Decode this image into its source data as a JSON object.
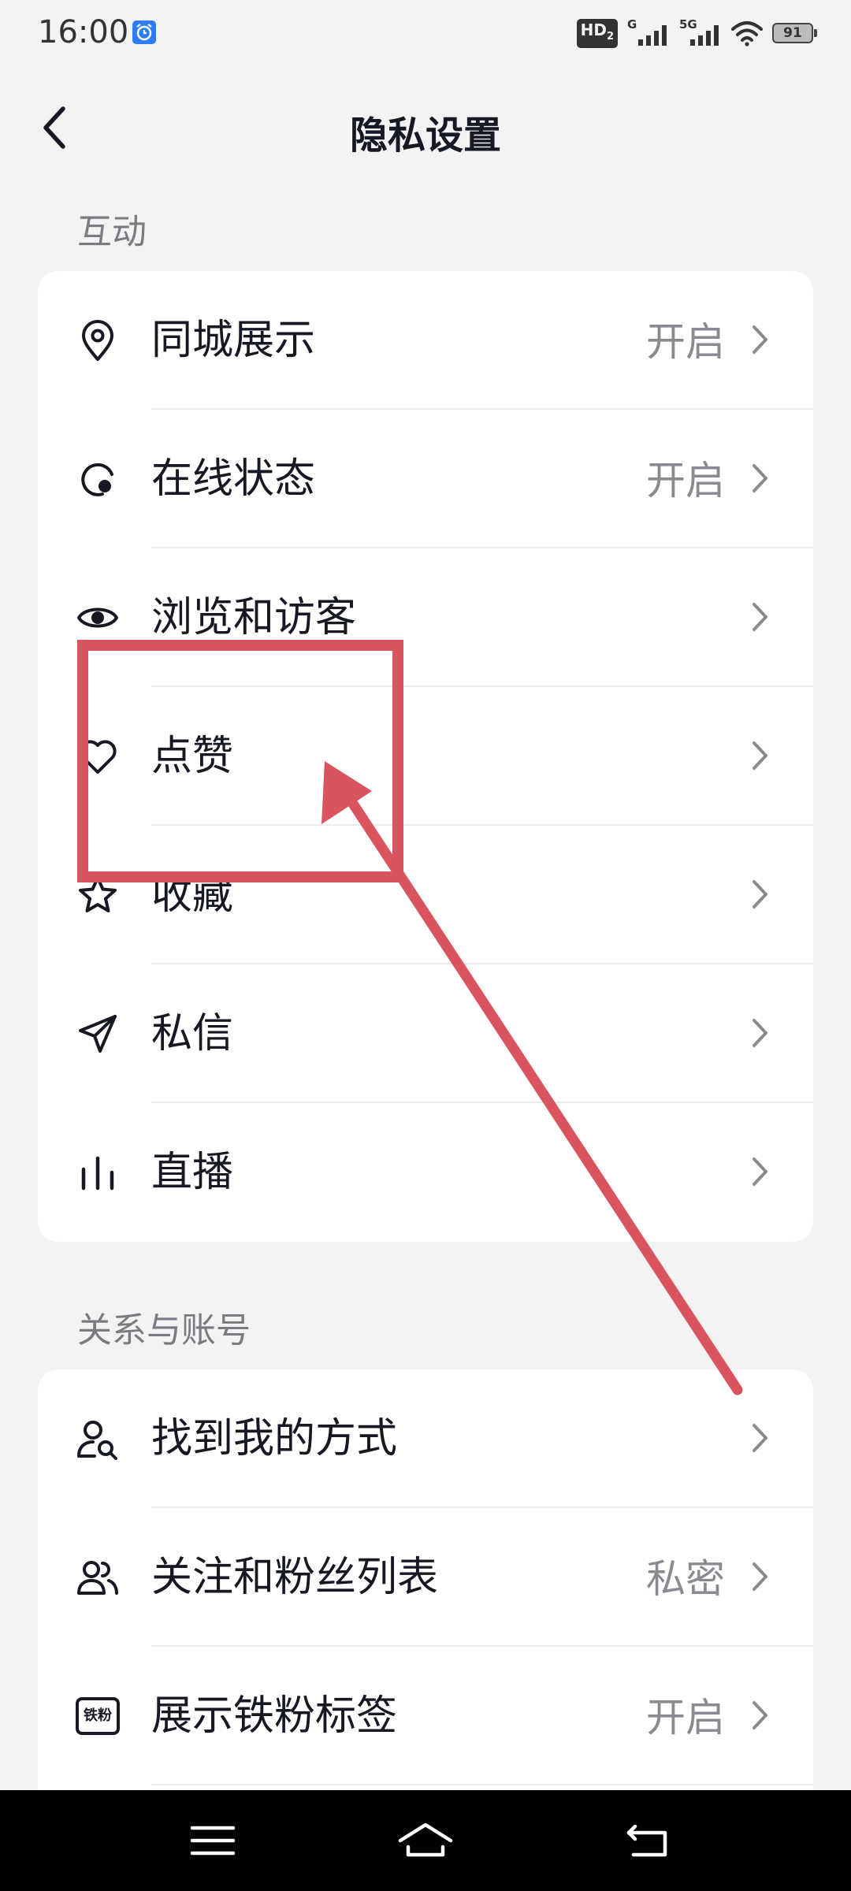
{
  "status_bar": {
    "time": "16:00",
    "hd_label": "HD",
    "hd_sub": "2",
    "signal_1_label": "G",
    "signal_2_label": "5G",
    "battery": "91"
  },
  "header": {
    "title": "隐私设置"
  },
  "sections": [
    {
      "title": "互动",
      "rows": [
        {
          "label": "同城展示",
          "value": "开启",
          "icon": "location-pin-icon"
        },
        {
          "label": "在线状态",
          "value": "开启",
          "icon": "online-status-icon"
        },
        {
          "label": "浏览和访客",
          "value": "",
          "icon": "eye-icon"
        },
        {
          "label": "点赞",
          "value": "",
          "icon": "heart-icon"
        },
        {
          "label": "收藏",
          "value": "",
          "icon": "star-icon"
        },
        {
          "label": "私信",
          "value": "",
          "icon": "send-icon"
        },
        {
          "label": "直播",
          "value": "",
          "icon": "live-bars-icon"
        }
      ]
    },
    {
      "title": "关系与账号",
      "rows": [
        {
          "label": "找到我的方式",
          "value": "",
          "icon": "user-search-icon"
        },
        {
          "label": "关注和粉丝列表",
          "value": "私密",
          "icon": "users-icon"
        },
        {
          "label": "展示铁粉标签",
          "value": "开启",
          "icon": "fan-badge-icon",
          "icon_text": "铁粉"
        }
      ]
    }
  ],
  "colors": {
    "background": "#f3f3f3",
    "card": "#ffffff",
    "primary_text": "#161823",
    "secondary_text": "#8a8a90",
    "annotation": "#d9545f",
    "nav_bar": "#000000"
  }
}
